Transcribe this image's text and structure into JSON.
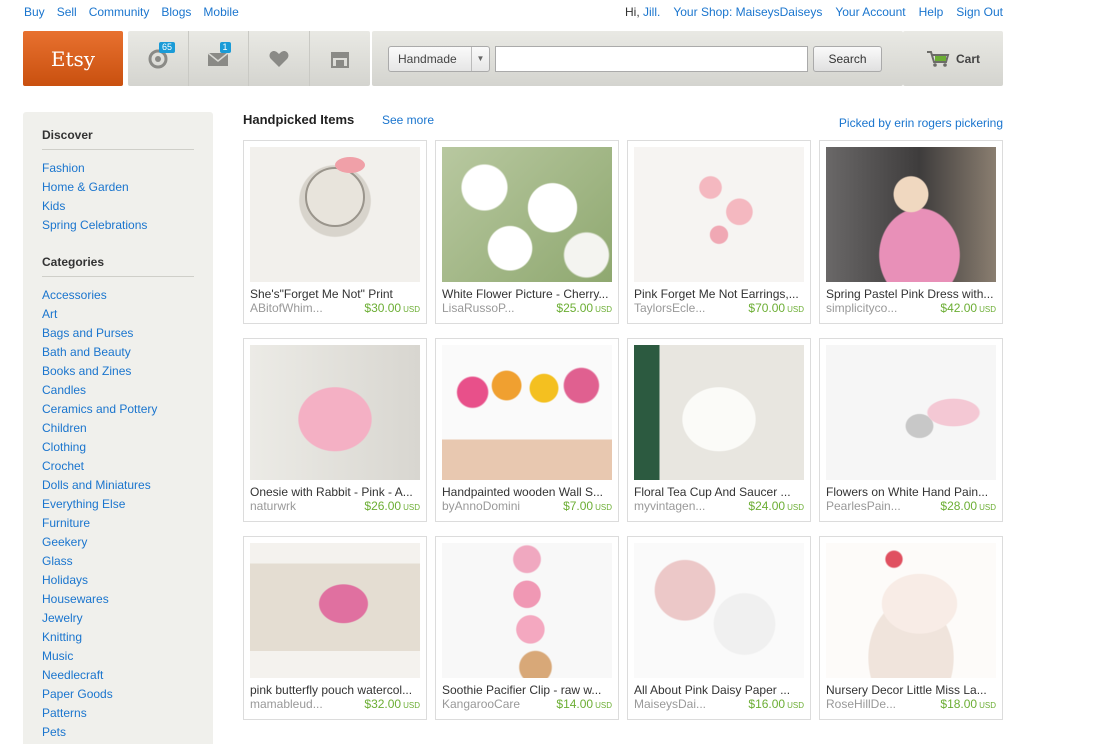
{
  "topnav": {
    "left": [
      "Buy",
      "Sell",
      "Community",
      "Blogs",
      "Mobile"
    ],
    "greeting": "Hi,",
    "user": "Jill.",
    "right": [
      "Your Shop: MaiseysDaiseys",
      "Your Account",
      "Help",
      "Sign Out"
    ]
  },
  "header": {
    "logo": "Etsy",
    "activity_count": "65",
    "messages_count": "1",
    "search_category": "Handmade",
    "search_value": "",
    "search_button": "Search",
    "cart_label": "Cart"
  },
  "sidebar": {
    "discover_title": "Discover",
    "discover": [
      "Fashion",
      "Home & Garden",
      "Kids",
      "Spring Celebrations"
    ],
    "categories_title": "Categories",
    "categories": [
      "Accessories",
      "Art",
      "Bags and Purses",
      "Bath and Beauty",
      "Books and Zines",
      "Candles",
      "Ceramics and Pottery",
      "Children",
      "Clothing",
      "Crochet",
      "Dolls and Miniatures",
      "Everything Else",
      "Furniture",
      "Geekery",
      "Glass",
      "Holidays",
      "Housewares",
      "Jewelry",
      "Knitting",
      "Music",
      "Needlecraft",
      "Paper Goods",
      "Patterns",
      "Pets"
    ]
  },
  "main": {
    "title": "Handpicked Items",
    "see_more": "See more",
    "picked_by": "Picked by erin rogers pickering",
    "items": [
      {
        "title": "She's\"Forget Me Not\" Print",
        "shop": "ABitofWhim...",
        "price": "$30.00",
        "currency": "USD"
      },
      {
        "title": "White Flower Picture - Cherry...",
        "shop": "LisaRussoP...",
        "price": "$25.00",
        "currency": "USD"
      },
      {
        "title": "Pink Forget Me Not Earrings,...",
        "shop": "TaylorsEcle...",
        "price": "$70.00",
        "currency": "USD"
      },
      {
        "title": "Spring Pastel Pink Dress with...",
        "shop": "simplicityco...",
        "price": "$42.00",
        "currency": "USD"
      },
      {
        "title": "Onesie with Rabbit - Pink - A...",
        "shop": "naturwrk",
        "price": "$26.00",
        "currency": "USD"
      },
      {
        "title": "Handpainted wooden Wall S...",
        "shop": "byAnnoDomini",
        "price": "$7.00",
        "currency": "USD"
      },
      {
        "title": "Floral Tea Cup And Saucer ...",
        "shop": "myvintagen...",
        "price": "$24.00",
        "currency": "USD"
      },
      {
        "title": "Flowers on White Hand Pain...",
        "shop": "PearlesPain...",
        "price": "$28.00",
        "currency": "USD"
      },
      {
        "title": "pink butterfly pouch watercol...",
        "shop": "mamableud...",
        "price": "$32.00",
        "currency": "USD"
      },
      {
        "title": "Soothie Pacifier Clip - raw w...",
        "shop": "KangarooCare",
        "price": "$14.00",
        "currency": "USD"
      },
      {
        "title": "All About Pink Daisy Paper ...",
        "shop": "MaiseysDai...",
        "price": "$16.00",
        "currency": "USD"
      },
      {
        "title": "Nursery Decor Little Miss La...",
        "shop": "RoseHillDe...",
        "price": "$18.00",
        "currency": "USD"
      }
    ]
  }
}
